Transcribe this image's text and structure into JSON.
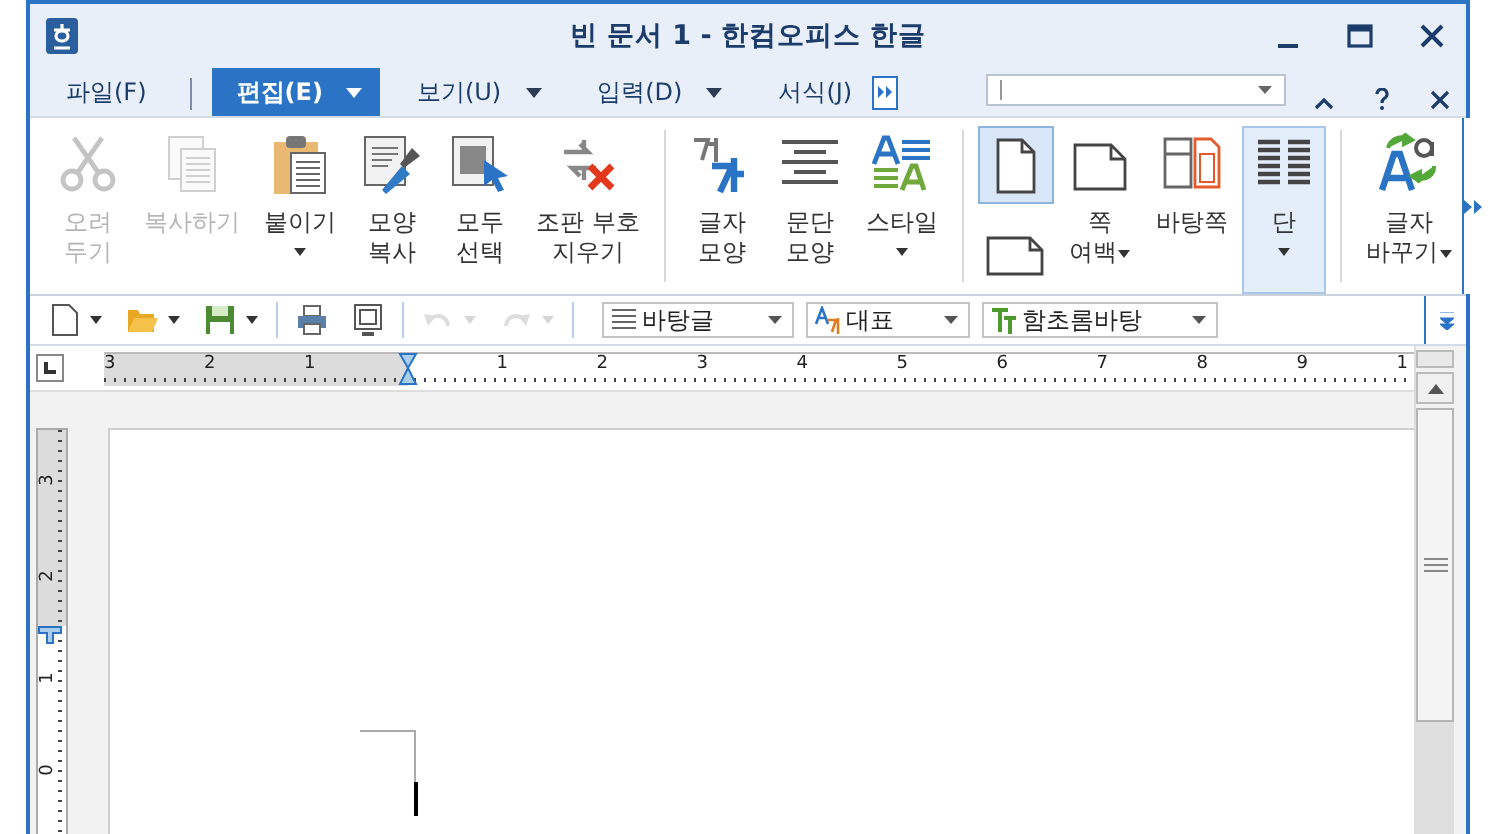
{
  "window": {
    "title": "빈 문서 1 - 한컴오피스 한글"
  },
  "menu_tabs": [
    {
      "label": "파일(F)",
      "selected": false,
      "dropdown": false
    },
    {
      "label": "편집(E)",
      "selected": true,
      "dropdown": true
    },
    {
      "label": "보기(U)",
      "selected": false,
      "dropdown": true
    },
    {
      "label": "입력(D)",
      "selected": false,
      "dropdown": true
    },
    {
      "label": "서식(J)",
      "selected": false,
      "dropdown": false
    }
  ],
  "ribbon": {
    "groups": [
      [
        {
          "kind": "button",
          "label": [
            "오려",
            "두기"
          ],
          "disabled": true,
          "selected": false
        },
        {
          "kind": "button",
          "label": [
            "복사하기"
          ],
          "disabled": true,
          "selected": false
        },
        {
          "kind": "button",
          "label": [
            "붙이기"
          ],
          "disabled": false,
          "selected": false
        },
        {
          "kind": "button",
          "label": [
            "모양",
            "복사"
          ],
          "disabled": false,
          "selected": false
        },
        {
          "kind": "button",
          "label": [
            "모두",
            "선택"
          ],
          "disabled": false,
          "selected": false
        },
        {
          "kind": "button",
          "label": [
            "조판 부호",
            "지우기"
          ],
          "disabled": false,
          "selected": false
        }
      ],
      [
        {
          "kind": "button",
          "label": [
            "글자",
            "모양"
          ],
          "disabled": false,
          "selected": false
        },
        {
          "kind": "button",
          "label": [
            "문단",
            "모양"
          ],
          "disabled": false,
          "selected": false
        },
        {
          "kind": "button",
          "label": [
            "스타일"
          ],
          "disabled": false,
          "selected": false
        }
      ],
      [
        {
          "kind": "orientation",
          "options": [
            {
              "selected": true
            },
            {
              "selected": false
            }
          ]
        },
        {
          "kind": "button",
          "label": [
            "쪽",
            "여백"
          ],
          "disabled": false,
          "selected": false
        },
        {
          "kind": "button",
          "label": [
            "바탕쪽"
          ],
          "disabled": false,
          "selected": false
        },
        {
          "kind": "button",
          "label": [
            "단"
          ],
          "disabled": false,
          "selected": true
        }
      ],
      [
        {
          "kind": "button",
          "label": [
            "글자",
            "바꾸기"
          ],
          "disabled": false,
          "selected": false
        }
      ]
    ]
  },
  "toolbar": {
    "buttons": [
      {
        "disabled": false
      },
      {
        "disabled": false
      },
      {
        "disabled": false
      },
      {
        "disabled": false
      },
      {
        "disabled": false
      },
      {
        "disabled": true
      },
      {
        "disabled": true
      }
    ],
    "combos": [
      {
        "value": "바탕글"
      },
      {
        "value": "대표"
      },
      {
        "value": "함초롬바탕"
      }
    ]
  },
  "ruler": {
    "left_labels": [
      "3",
      "2",
      "1"
    ],
    "right_labels": [
      "1",
      "2",
      "3",
      "4",
      "5",
      "6",
      "7",
      "8",
      "9",
      "1"
    ]
  },
  "vertical_ruler": {
    "upper_labels": [
      "3",
      "2"
    ],
    "lower_labels": [
      "1",
      "0"
    ]
  }
}
